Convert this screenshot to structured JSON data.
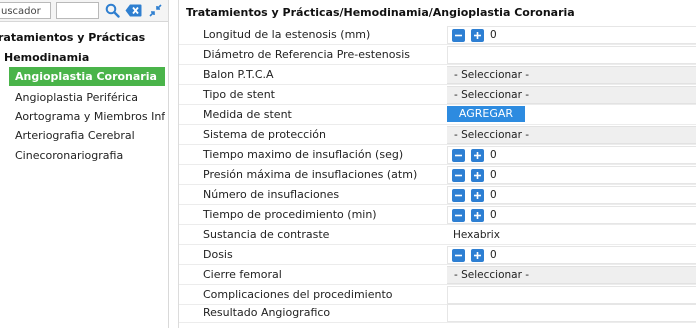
{
  "search": {
    "input_value": "uscador"
  },
  "tree": {
    "root_label": "ratamientos y Prácticas",
    "group_label": "Hemodinamia",
    "items": [
      {
        "label": "Angioplastia Coronaria",
        "selected": true
      },
      {
        "label": "Angioplastia Periférica",
        "selected": false
      },
      {
        "label": "Aortograma y Miembros Inferiores",
        "selected": false
      },
      {
        "label": "Arteriografia Cerebral",
        "selected": false
      },
      {
        "label": "Cinecoronariografia",
        "selected": false
      }
    ]
  },
  "panel": {
    "title": "Tratamientos y Prácticas/Hemodinamia/Angioplastia Coronaria"
  },
  "form": {
    "rows": [
      {
        "label": "Longitud de la estenosis (mm)",
        "type": "stepper",
        "value": "0"
      },
      {
        "label": "Diámetro de Referencia Pre-estenosis",
        "type": "plain",
        "value": ""
      },
      {
        "label": "Balon P.T.C.A",
        "type": "select",
        "value": "- Seleccionar -"
      },
      {
        "label": "Tipo de stent",
        "type": "select",
        "value": "- Seleccionar -"
      },
      {
        "label": "Medida de stent",
        "type": "button",
        "value": "AGREGAR"
      },
      {
        "label": "Sistema de protección",
        "type": "select",
        "value": "- Seleccionar -"
      },
      {
        "label": "Tiempo maximo de insuflación (seg)",
        "type": "stepper",
        "value": "0"
      },
      {
        "label": "Presión máxima de insuflaciones (atm)",
        "type": "stepper",
        "value": "0"
      },
      {
        "label": "Número de insuflaciones",
        "type": "stepper",
        "value": "0"
      },
      {
        "label": "Tiempo de procedimiento (min)",
        "type": "stepper",
        "value": "0"
      },
      {
        "label": "Sustancia de contraste",
        "type": "text",
        "value": "Hexabrix"
      },
      {
        "label": "Dosis",
        "type": "stepper",
        "value": "0"
      },
      {
        "label": "Cierre femoral",
        "type": "select",
        "value": "- Seleccionar -"
      },
      {
        "label": "Complicaciones del procedimiento",
        "type": "plain",
        "value": ""
      },
      {
        "label": "Resultado Angiografico",
        "type": "plain",
        "value": ""
      }
    ]
  },
  "colors": {
    "selected_item_bg": "#4ab44a",
    "accent_blue": "#2d7fd3",
    "select_bg": "#efefef"
  },
  "icons": {
    "search": "search-icon",
    "clear": "clear-search-icon",
    "collapse": "collapse-arrows-icon",
    "minus": "minus-icon",
    "plus": "plus-icon"
  }
}
